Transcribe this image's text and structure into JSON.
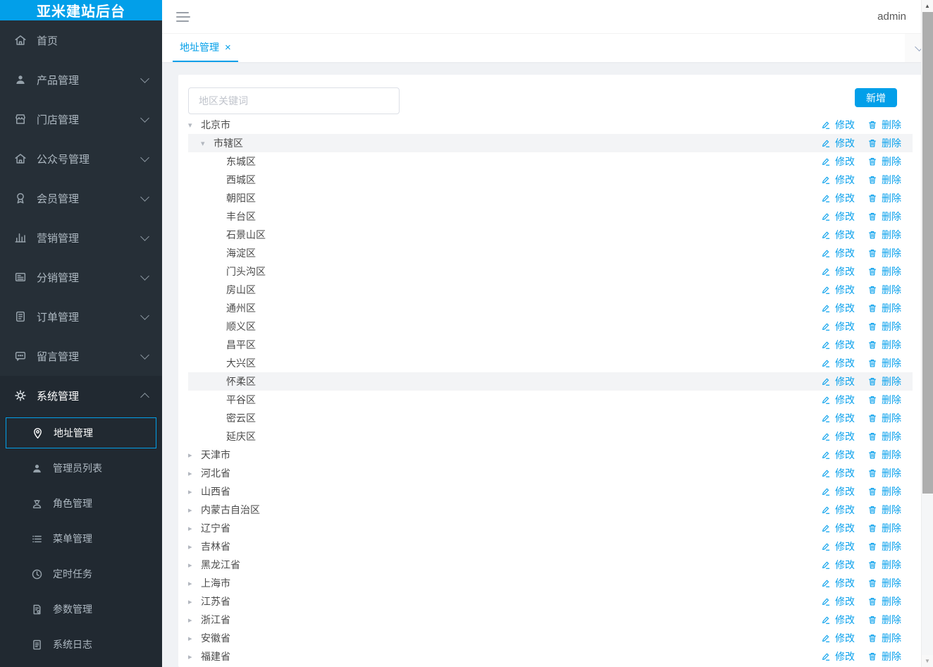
{
  "colors": {
    "accent": "#029fe9",
    "link": "#0aa1ec",
    "sidebar_bg": "#262f37",
    "sidebar_active_bg": "#212931",
    "content_bg": "#f0f2f5",
    "row_highlight": "#f3f4f6"
  },
  "app": {
    "logo": "亚米建站后台",
    "user": "admin"
  },
  "sidebar": {
    "items": [
      {
        "label": "首页",
        "icon": "home-icon",
        "arrow": "none",
        "active": false
      },
      {
        "label": "产品管理",
        "icon": "user-icon",
        "arrow": "down",
        "active": false
      },
      {
        "label": "门店管理",
        "icon": "store-icon",
        "arrow": "down",
        "active": false
      },
      {
        "label": "公众号管理",
        "icon": "home-icon",
        "arrow": "down",
        "active": false
      },
      {
        "label": "会员管理",
        "icon": "badge-icon",
        "arrow": "down",
        "active": false
      },
      {
        "label": "营销管理",
        "icon": "chart-icon",
        "arrow": "down",
        "active": false
      },
      {
        "label": "分销管理",
        "icon": "image-icon",
        "arrow": "down",
        "active": false
      },
      {
        "label": "订单管理",
        "icon": "order-icon",
        "arrow": "down",
        "active": false
      },
      {
        "label": "留言管理",
        "icon": "message-icon",
        "arrow": "down",
        "active": false
      },
      {
        "label": "系统管理",
        "icon": "gear-icon",
        "arrow": "up",
        "active": true
      }
    ],
    "submenu": [
      {
        "label": "地址管理",
        "icon": "location-icon",
        "selected": true
      },
      {
        "label": "管理员列表",
        "icon": "user-icon",
        "selected": false
      },
      {
        "label": "角色管理",
        "icon": "role-icon",
        "selected": false
      },
      {
        "label": "菜单管理",
        "icon": "menu-list-icon",
        "selected": false
      },
      {
        "label": "定时任务",
        "icon": "clock-icon",
        "selected": false
      },
      {
        "label": "参数管理",
        "icon": "params-icon",
        "selected": false
      },
      {
        "label": "系统日志",
        "icon": "log-icon",
        "selected": false
      }
    ]
  },
  "tabbar": {
    "active_tab": "地址管理",
    "close_symbol": "×"
  },
  "toolbar": {
    "search_placeholder": "地区关键词",
    "add_label": "新增"
  },
  "actions": {
    "edit": "修改",
    "delete": "删除"
  },
  "tree": [
    {
      "label": "北京市",
      "level": 0,
      "state": "open",
      "highlight": false
    },
    {
      "label": "市辖区",
      "level": 1,
      "state": "open",
      "highlight": true
    },
    {
      "label": "东城区",
      "level": 2,
      "state": "leaf",
      "highlight": false
    },
    {
      "label": "西城区",
      "level": 2,
      "state": "leaf",
      "highlight": false
    },
    {
      "label": "朝阳区",
      "level": 2,
      "state": "leaf",
      "highlight": false
    },
    {
      "label": "丰台区",
      "level": 2,
      "state": "leaf",
      "highlight": false
    },
    {
      "label": "石景山区",
      "level": 2,
      "state": "leaf",
      "highlight": false
    },
    {
      "label": "海淀区",
      "level": 2,
      "state": "leaf",
      "highlight": false
    },
    {
      "label": "门头沟区",
      "level": 2,
      "state": "leaf",
      "highlight": false
    },
    {
      "label": "房山区",
      "level": 2,
      "state": "leaf",
      "highlight": false
    },
    {
      "label": "通州区",
      "level": 2,
      "state": "leaf",
      "highlight": false
    },
    {
      "label": "顺义区",
      "level": 2,
      "state": "leaf",
      "highlight": false
    },
    {
      "label": "昌平区",
      "level": 2,
      "state": "leaf",
      "highlight": false
    },
    {
      "label": "大兴区",
      "level": 2,
      "state": "leaf",
      "highlight": false
    },
    {
      "label": "怀柔区",
      "level": 2,
      "state": "leaf",
      "highlight": true
    },
    {
      "label": "平谷区",
      "level": 2,
      "state": "leaf",
      "highlight": false
    },
    {
      "label": "密云区",
      "level": 2,
      "state": "leaf",
      "highlight": false
    },
    {
      "label": "延庆区",
      "level": 2,
      "state": "leaf",
      "highlight": false
    },
    {
      "label": "天津市",
      "level": 0,
      "state": "closed",
      "highlight": false
    },
    {
      "label": "河北省",
      "level": 0,
      "state": "closed",
      "highlight": false
    },
    {
      "label": "山西省",
      "level": 0,
      "state": "closed",
      "highlight": false
    },
    {
      "label": "内蒙古自治区",
      "level": 0,
      "state": "closed",
      "highlight": false
    },
    {
      "label": "辽宁省",
      "level": 0,
      "state": "closed",
      "highlight": false
    },
    {
      "label": "吉林省",
      "level": 0,
      "state": "closed",
      "highlight": false
    },
    {
      "label": "黑龙江省",
      "level": 0,
      "state": "closed",
      "highlight": false
    },
    {
      "label": "上海市",
      "level": 0,
      "state": "closed",
      "highlight": false
    },
    {
      "label": "江苏省",
      "level": 0,
      "state": "closed",
      "highlight": false
    },
    {
      "label": "浙江省",
      "level": 0,
      "state": "closed",
      "highlight": false
    },
    {
      "label": "安徽省",
      "level": 0,
      "state": "closed",
      "highlight": false
    },
    {
      "label": "福建省",
      "level": 0,
      "state": "closed",
      "highlight": false
    }
  ],
  "scrollbar": {
    "up_symbol": "▲",
    "down_symbol": "▼"
  }
}
